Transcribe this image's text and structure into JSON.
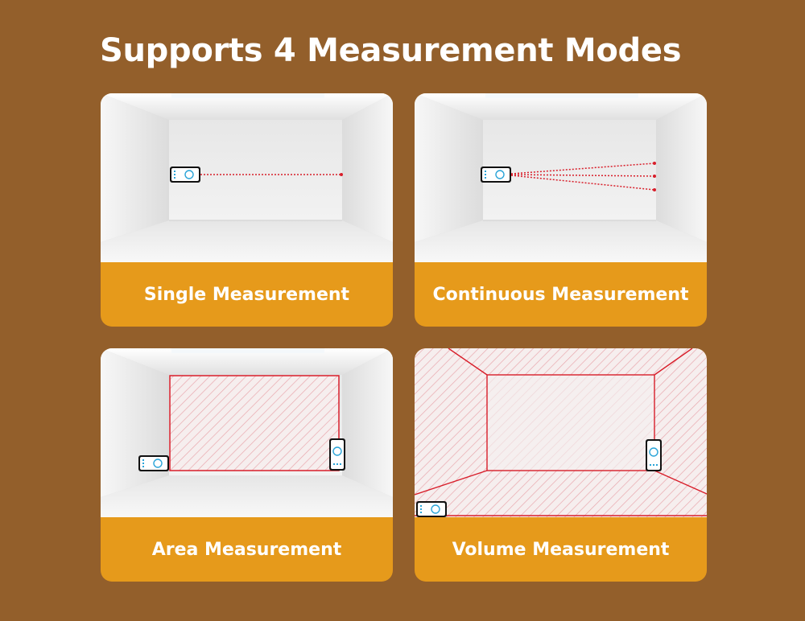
{
  "title": "Supports 4 Measurement Modes",
  "modes": [
    {
      "label": "Single Measurement",
      "icon": "single-laser-icon"
    },
    {
      "label": "Continuous Measurement",
      "icon": "continuous-laser-icon"
    },
    {
      "label": "Area Measurement",
      "icon": "area-icon"
    },
    {
      "label": "Volume Measurement",
      "icon": "volume-icon"
    }
  ],
  "colors": {
    "background": "#935f2b",
    "accent": "#e69a1b",
    "laser": "#d81e2a",
    "device_screen": "#2aa4d8"
  }
}
